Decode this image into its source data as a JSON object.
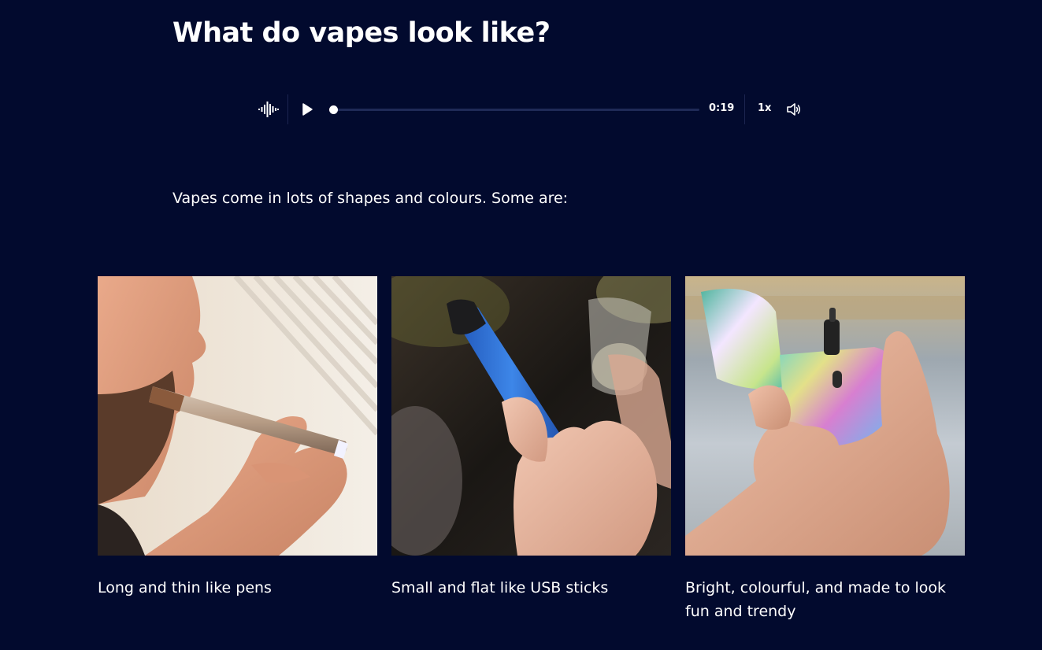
{
  "title": "What do vapes look like?",
  "player": {
    "icon_wave": "audio-wave-icon",
    "icon_play": "play-icon",
    "icon_volume": "volume-icon",
    "progress": 0.0,
    "time": "0:19",
    "speed": "1x"
  },
  "intro": "Vapes come in lots of shapes and colours. Some are:",
  "cards": [
    {
      "caption": "Long and thin like pens",
      "image": "pen-vape-photo"
    },
    {
      "caption": "Small and flat like USB sticks",
      "image": "usb-vape-photo"
    },
    {
      "caption": "Bright, colourful, and made to look fun and trendy",
      "image": "colourful-vape-photo"
    }
  ],
  "colors": {
    "background": "#020a2e",
    "text": "#ffffff",
    "track": "#1f2a57"
  }
}
